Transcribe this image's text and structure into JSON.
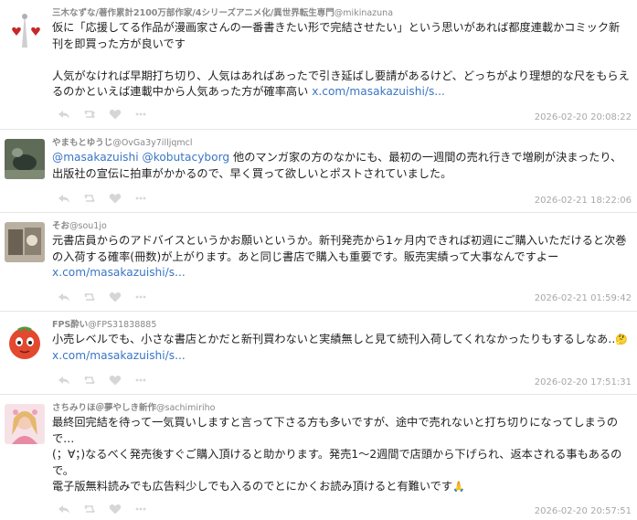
{
  "posts": [
    {
      "display_name": "三木なずな/著作累計2100万部作家/4シリーズアニメ化/異世界転生専門",
      "handle": "@mikinazuna",
      "text_main": "仮に「応援してる作品が漫画家さんの一番書きたい形で完結させたい」という思いがあれば都度連載かコミック新刊を即買った方が良いです\n\n人気がなければ早期打ち切り、人気はあればあったで引き延ばし要請があるけど、どっちがより理想的な尺をもらえるのかといえば連載中から人気あった方が確率高い ",
      "link": "x.com/masakazuishi/s...",
      "timestamp": "2026-02-20 20:08:22"
    },
    {
      "display_name": "やまもとゆうじ",
      "handle": "@OvGa3y7illjqmcl",
      "mention1": "@masakazuishi",
      "mention2": "@kobutacyborg",
      "text_main": " 他のマンガ家の方のなかにも、最初の一週間の売れ行きで増刷が決まったり、出版社の宣伝に拍車がかかるので、早く買って欲しいとポストされていました。",
      "timestamp": "2026-02-21 18:22:06"
    },
    {
      "display_name": "そお",
      "handle": "@sou1jo",
      "text_main": "元書店員からのアドバイスというかお願いというか。新刊発売から1ヶ月内できれば初週にご購入いただけると次巻の入荷する確率(冊数)が上がります。あと同じ書店で購入も重要です。販売実績って大事なんですよー ",
      "link": "x.com/masakazuishi/s...",
      "timestamp": "2026-02-21 01:59:42"
    },
    {
      "display_name": "FPS酔い",
      "handle": "@FPS31838885",
      "text_main": "小売レベルでも、小さな書店とかだと新刊買わないと実績無しと見て続刊入荷してくれなかったりもするしなあ‥",
      "emoji": "🤔",
      "link": "x.com/masakazuishi/s...",
      "timestamp": "2026-02-20 17:51:31"
    },
    {
      "display_name": "さちみりほ＠夢やしき新作",
      "handle": "@sachimiriho",
      "text_main": "最終回完結を待って一気買いしますと言って下さる方も多いですが、途中で売れないと打ち切りになってしまうので…\n(；∀；)なるべく発売後すぐご購入頂けると助かります。発売1〜2週間で店頭から下げられ、返本される事もあるので。\n電子版無料読みでも広告料少しでも入るのでとにかくお読み頂けると有難いです",
      "emoji": "🙏",
      "timestamp": "2026-02-20 20:57:51"
    }
  ],
  "icons": [
    "reply-icon",
    "repost-icon",
    "like-icon",
    "more-icon"
  ],
  "colors": {
    "link": "#3a76c4",
    "meta": "#888888",
    "timestamp": "#a8a8a8"
  }
}
